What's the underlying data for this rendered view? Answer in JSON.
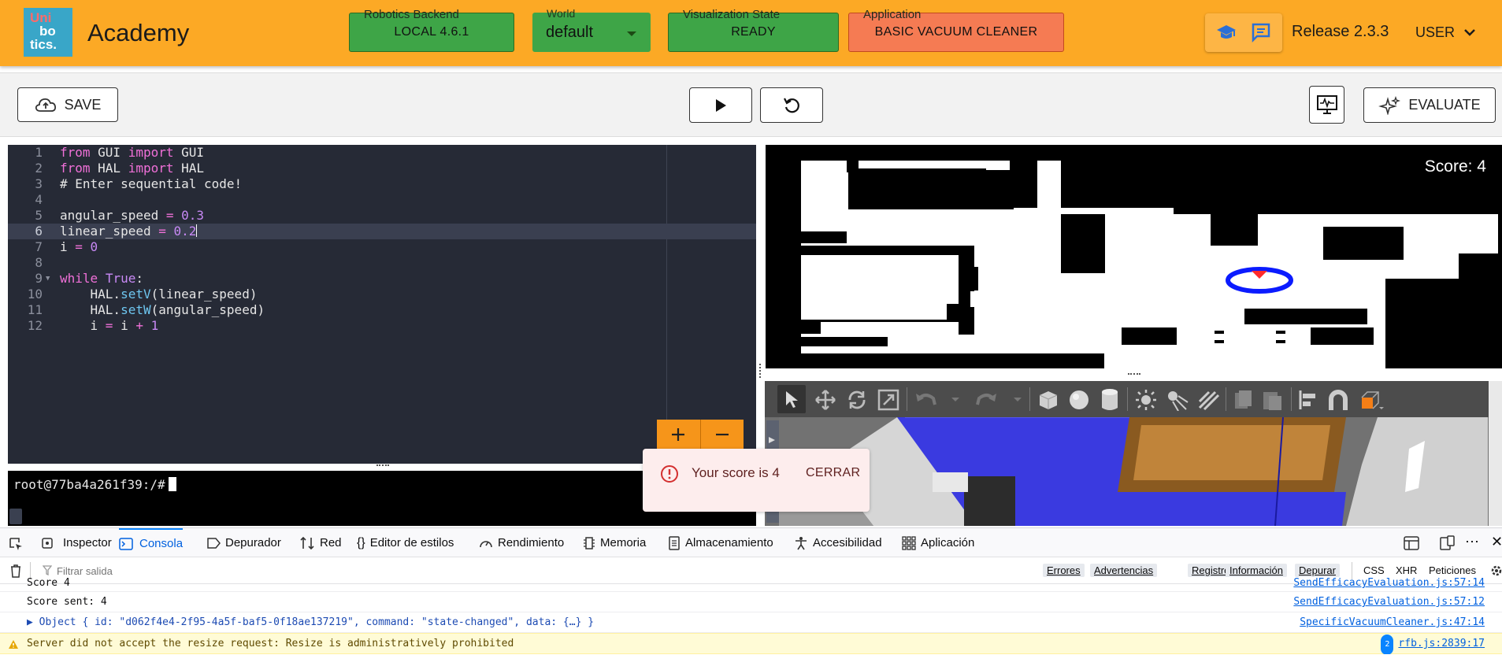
{
  "header": {
    "logo_lines": [
      "Uni",
      "bo",
      "tics."
    ],
    "brand": "Academy",
    "backend": {
      "label": "Robotics Backend",
      "value": "LOCAL 4.6.1"
    },
    "world": {
      "label": "World",
      "value": "default"
    },
    "visualization": {
      "label": "Visualization State",
      "value": "READY"
    },
    "application": {
      "label": "Application",
      "value": "BASIC VACUUM CLEANER"
    },
    "release": "Release 2.3.3",
    "user": "USER",
    "colors": {
      "bar": "#fca925",
      "green": "#3ea547",
      "orange": "#f57b53"
    }
  },
  "toolbar": {
    "save_label": "SAVE",
    "evaluate_label": "EVALUATE"
  },
  "editor": {
    "lines": [
      {
        "n": "1",
        "code": "from GUI import GUI"
      },
      {
        "n": "2",
        "code": "from HAL import HAL"
      },
      {
        "n": "3",
        "code": "# Enter sequential code!"
      },
      {
        "n": "4",
        "code": ""
      },
      {
        "n": "5",
        "code": "angular_speed = 0.3"
      },
      {
        "n": "6",
        "code": "linear_speed = 0.2"
      },
      {
        "n": "7",
        "code": "i = 0"
      },
      {
        "n": "8",
        "code": ""
      },
      {
        "n": "9",
        "code": "while True:"
      },
      {
        "n": "10",
        "code": "    HAL.setV(linear_speed)"
      },
      {
        "n": "11",
        "code": "    HAL.setW(angular_speed)"
      },
      {
        "n": "12",
        "code": "    i = i + 1"
      }
    ],
    "active_line": "6"
  },
  "terminal": {
    "prompt": "root@77ba4a261f39:/#"
  },
  "map": {
    "score_text": "Score:  4"
  },
  "toast": {
    "message": "Your score is 4",
    "close_label": "CERRAR"
  },
  "devtools": {
    "tabs": [
      "Inspector",
      "Consola",
      "Depurador",
      "Red",
      "Editor de estilos",
      "Rendimiento",
      "Memoria",
      "Almacenamiento",
      "Accesibilidad",
      "Aplicación"
    ],
    "selected_tab": "Consola",
    "filter_placeholder": "Filtrar salida",
    "filters": [
      "Errores",
      "Advertencias",
      "Registros",
      "Información",
      "Depurar"
    ],
    "extra_filters": [
      "CSS",
      "XHR",
      "Peticiones"
    ],
    "logs": [
      {
        "text": "Score 4",
        "source": "SendEfficacyEvaluation.js:57:14"
      },
      {
        "text": "Score sent:  4",
        "source": "SendEfficacyEvaluation.js:57:12"
      },
      {
        "text": "▶ Object { id: \"d062f4e4-2f95-4a5f-baf5-0f18ae137219\", command: \"state-changed\", data: {…} }",
        "source": "SpecificVacuumCleaner.js:47:14"
      },
      {
        "text": "Server did not accept the resize request: Resize is administratively prohibited",
        "source": "rfb.js:2839:17",
        "count": "2"
      }
    ]
  }
}
